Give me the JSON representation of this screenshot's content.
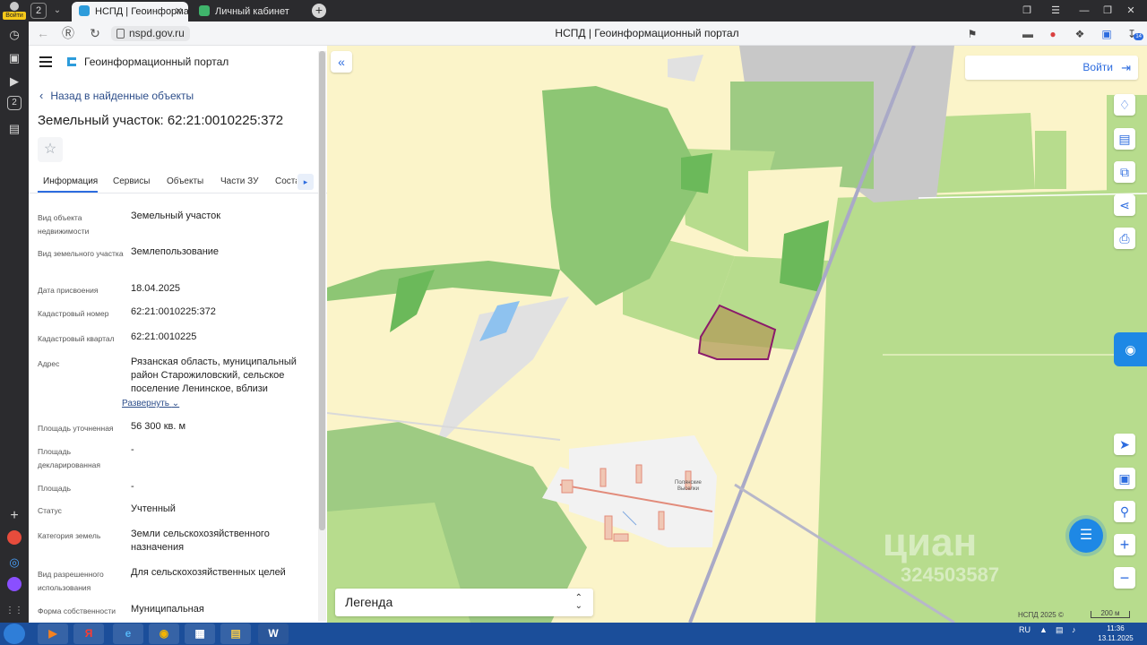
{
  "browser": {
    "rail_login_label": "Войти",
    "tab_count_badge": "2",
    "tabs": [
      {
        "label": "НСПД | Геоинформацио",
        "active": true
      },
      {
        "label": "Личный кабинет",
        "active": false
      }
    ],
    "new_tab": "+",
    "url": "nspd.gov.ru",
    "page_title": "НСПД | Геоинформационный портал",
    "ext_badge": "14",
    "rail_badge": "2",
    "icons": [
      "history-icon",
      "bookmarks-icon",
      "collections-icon",
      "play-icon",
      "settings-icon",
      "add-icon",
      "mail-icon",
      "messenger-icon",
      "alice-icon",
      "more-icon"
    ]
  },
  "panel": {
    "brand": "Геоинформационный портал",
    "back_link": "Назад в найденные объекты",
    "title": "Земельный участок: 62:21:0010225:372",
    "tabs": [
      "Информация",
      "Сервисы",
      "Объекты",
      "Части ЗУ",
      "Соста"
    ],
    "active_tab": "Информация",
    "fields": [
      {
        "key": "Вид объекта недвижимости",
        "value": "Земельный участок"
      },
      {
        "key": "Вид земельного участка",
        "value": "Землепользование"
      },
      {
        "key": "Дата присвоения",
        "value": "18.04.2025"
      },
      {
        "key": "Кадастровый номер",
        "value": "62:21:0010225:372"
      },
      {
        "key": "Кадастровый квартал",
        "value": "62:21:0010225"
      },
      {
        "key": "Адрес",
        "value": "Рязанская область, муниципальный район Старожиловский, сельское поселение Ленинское, вблизи"
      },
      {
        "key": "Площадь уточненная",
        "value": "56 300 кв. м"
      },
      {
        "key": "Площадь декларированная",
        "value": "-"
      },
      {
        "key": "Площадь",
        "value": "-"
      },
      {
        "key": "Статус",
        "value": "Учтенный"
      },
      {
        "key": "Категория земель",
        "value": "Земли сельскохозяйственного назначения"
      },
      {
        "key": "Вид разрешенного использования",
        "value": "Для сельскохозяйственных целей"
      },
      {
        "key": "Форма собственности",
        "value": "Муниципальная"
      }
    ],
    "expand_link": "Развернуть"
  },
  "map": {
    "login_button": "Войти",
    "legend_label": "Легенда",
    "settlement_label_1": "Полянские",
    "settlement_label_2": "Выселки",
    "watermark_word": "циан",
    "watermark_number": "324503587",
    "attribution": "НСПД 2025 ©",
    "scale_label": "200 м",
    "colors": {
      "parcel_outline": "#8b1a6b",
      "field_green": "#a9d77a",
      "forest_green": "#6bb95a",
      "water": "#8ec2ef"
    }
  },
  "taskbar": {
    "lang": "RU",
    "time": "11:36",
    "date": "13.11.2025"
  }
}
